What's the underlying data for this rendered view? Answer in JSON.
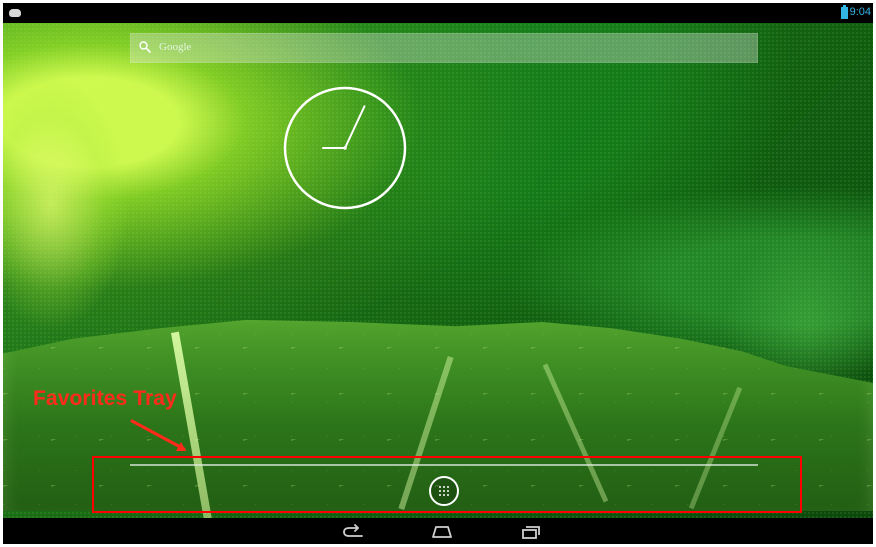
{
  "status_bar": {
    "time": "9:04"
  },
  "search": {
    "placeholder": "Google"
  },
  "clock": {
    "hour_hand_angle_deg": 270,
    "minute_hand_angle_deg": 25
  },
  "annotation": {
    "label": "Favorites Tray",
    "color": "#ff2a1a"
  },
  "tray": {
    "all_apps_icon": "grid-icon"
  },
  "navbar": {
    "back_icon": "back-icon",
    "home_icon": "home-icon",
    "recents_icon": "recents-icon"
  }
}
